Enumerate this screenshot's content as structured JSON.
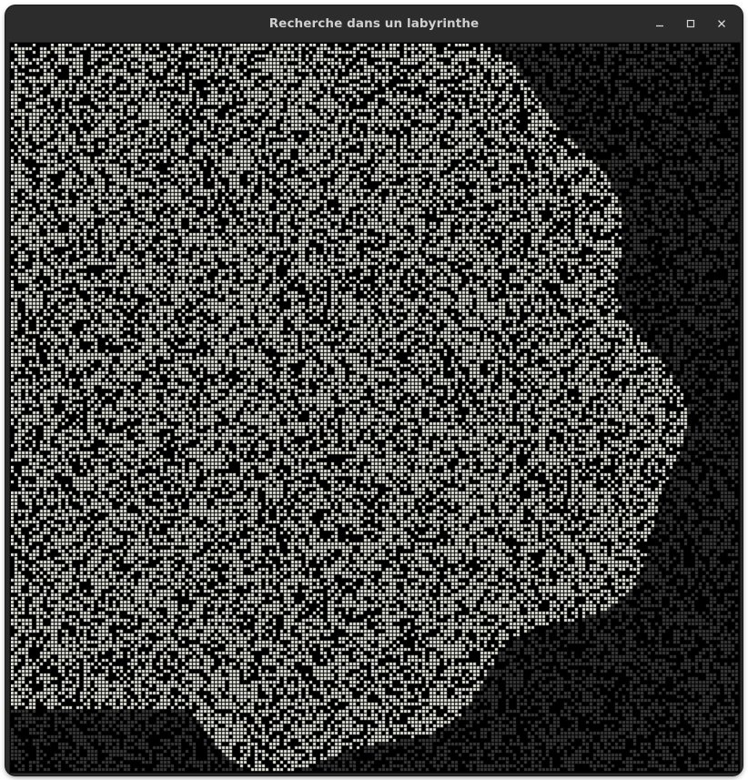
{
  "window": {
    "title": "Recherche dans un labyrinthe",
    "controls": {
      "minimize_icon": "minimize-icon",
      "maximize_icon": "maximize-icon",
      "close_icon": "close-icon"
    }
  },
  "maze": {
    "visited_color": "#e8e8e0",
    "unvisited_color": "#3a3a3a",
    "wall_color": "#000000"
  }
}
